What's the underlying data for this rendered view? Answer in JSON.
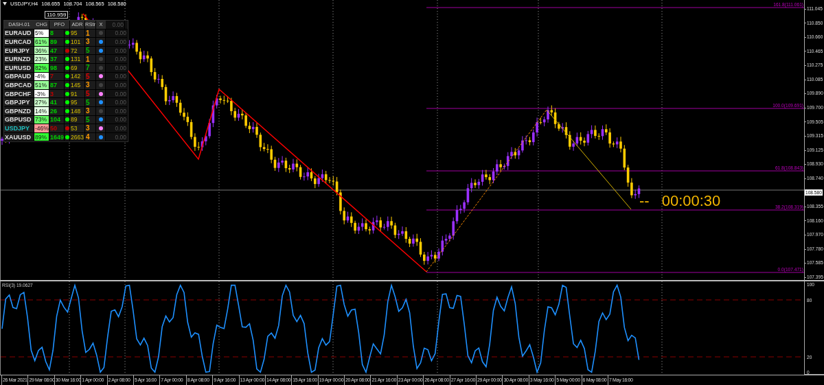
{
  "header": {
    "symbol_timeframe": "USDJPY,H4",
    "ohlc": [
      "108.655",
      "108.704",
      "108.565",
      "108.580"
    ]
  },
  "dashboard": {
    "high_label": "110.959",
    "title": "DASH.01",
    "columns": [
      "CHG",
      "PFO",
      "ADR",
      "RStr"
    ],
    "close": "X",
    "total": "0.00",
    "rows": [
      {
        "symbol": {
          "text": "EURAUD",
          "color": "#e0e0e0"
        },
        "chg": {
          "text": "5%",
          "color": "#ffffff"
        },
        "pfo": {
          "text": "8",
          "color": "#00d000"
        },
        "trend": {
          "color": "#00ff00"
        },
        "adr": "95",
        "rstr": {
          "text": "1",
          "color": "#ff9900"
        },
        "signal": {
          "color": "#404040"
        },
        "value": "0.00"
      },
      {
        "symbol": {
          "text": "EURCAD",
          "color": "#e0e0e0"
        },
        "chg": {
          "text": "61%",
          "color": "#80ff80"
        },
        "pfo": {
          "text": "89",
          "color": "#00d000"
        },
        "trend": {
          "color": "#00ff00"
        },
        "adr": "101",
        "rstr": {
          "text": "3",
          "color": "#ff9900"
        },
        "signal": {
          "color": "#1e90ff"
        },
        "value": "0.00"
      },
      {
        "symbol": {
          "text": "EURJPY",
          "color": "#e0e0e0"
        },
        "chg": {
          "text": "36%",
          "color": "#b8ffb8"
        },
        "pfo": {
          "text": "47",
          "color": "#00d000"
        },
        "trend": {
          "color": "#c00000"
        },
        "adr": "72",
        "rstr": {
          "text": "5",
          "color": "#00c000"
        },
        "signal": {
          "color": "#1e90ff"
        },
        "value": "0.00"
      },
      {
        "symbol": {
          "text": "EURNZD",
          "color": "#e0e0e0"
        },
        "chg": {
          "text": "23%",
          "color": "#d4ffd4"
        },
        "pfo": {
          "text": "37",
          "color": "#00d000"
        },
        "trend": {
          "color": "#00ff00"
        },
        "adr": "131",
        "rstr": {
          "text": "1",
          "color": "#ff9900"
        },
        "signal": {
          "color": "#404040"
        },
        "value": "0.00"
      },
      {
        "symbol": {
          "text": "EURUSD",
          "color": "#e0e0e0"
        },
        "chg": {
          "text": "82%",
          "color": "#4dff4d"
        },
        "pfo": {
          "text": "98",
          "color": "#00d000"
        },
        "trend": {
          "color": "#00ff00"
        },
        "adr": "69",
        "rstr": {
          "text": "7",
          "color": "#00c000"
        },
        "signal": {
          "color": "#404040"
        },
        "value": "0.00"
      },
      {
        "symbol": {
          "text": "GBPAUD",
          "color": "#e0e0e0"
        },
        "chg": {
          "text": "-4%",
          "color": "#ffffff"
        },
        "pfo": {
          "text": "7",
          "color": "#c00000"
        },
        "trend": {
          "color": "#00ff00"
        },
        "adr": "142",
        "rstr": {
          "text": "5",
          "color": "#e00000"
        },
        "signal": {
          "color": "#ff80ff"
        },
        "value": "0.00"
      },
      {
        "symbol": {
          "text": "GBPCAD",
          "color": "#e0e0e0"
        },
        "chg": {
          "text": "51%",
          "color": "#99ff99"
        },
        "pfo": {
          "text": "87",
          "color": "#00d000"
        },
        "trend": {
          "color": "#00ff00"
        },
        "adr": "145",
        "rstr": {
          "text": "3",
          "color": "#ff9900"
        },
        "signal": {
          "color": "#404040"
        },
        "value": "0.00"
      },
      {
        "symbol": {
          "text": "GBPCHF",
          "color": "#e0e0e0"
        },
        "chg": {
          "text": "-3%",
          "color": "#ffffff"
        },
        "pfo": {
          "text": "3",
          "color": "#c00000"
        },
        "trend": {
          "color": "#00ff00"
        },
        "adr": "91",
        "rstr": {
          "text": "5",
          "color": "#e00000"
        },
        "signal": {
          "color": "#ff80ff"
        },
        "value": "0.00"
      },
      {
        "symbol": {
          "text": "GBPJPY",
          "color": "#e0e0e0"
        },
        "chg": {
          "text": "27%",
          "color": "#ccffcc"
        },
        "pfo": {
          "text": "41",
          "color": "#00d000"
        },
        "trend": {
          "color": "#00ff00"
        },
        "adr": "95",
        "rstr": {
          "text": "5",
          "color": "#00c000"
        },
        "signal": {
          "color": "#1e90ff"
        },
        "value": "0.00"
      },
      {
        "symbol": {
          "text": "GBPNZD",
          "color": "#e0e0e0"
        },
        "chg": {
          "text": "14%",
          "color": "#e6ffe6"
        },
        "pfo": {
          "text": "26",
          "color": "#00d000"
        },
        "trend": {
          "color": "#00ff00"
        },
        "adr": "148",
        "rstr": {
          "text": "3",
          "color": "#ff9900"
        },
        "signal": {
          "color": "#404040"
        },
        "value": "0.00"
      },
      {
        "symbol": {
          "text": "GBPUSD",
          "color": "#e0e0e0"
        },
        "chg": {
          "text": "73%",
          "color": "#66ff66"
        },
        "pfo": {
          "text": "104",
          "color": "#00d000"
        },
        "trend": {
          "color": "#00ff00"
        },
        "adr": "89",
        "rstr": {
          "text": "5",
          "color": "#00c000"
        },
        "signal": {
          "color": "#1e90ff"
        },
        "value": "0.00"
      },
      {
        "symbol": {
          "text": "USDJPY",
          "color": "#20c0c0"
        },
        "chg": {
          "text": "-46%",
          "color": "#ff9999"
        },
        "pfo": {
          "text": "50",
          "color": "#c00000"
        },
        "trend": {
          "color": "#c00000"
        },
        "adr": "53",
        "rstr": {
          "text": "3",
          "color": "#ff9900"
        },
        "signal": {
          "color": "#ff80ff"
        },
        "value": "0.00"
      },
      {
        "symbol": {
          "text": "XAUUSD",
          "color": "#e0e0e0"
        },
        "chg": {
          "text": "89%",
          "color": "#33ff33"
        },
        "pfo": {
          "text": "1649",
          "color": "#00d000"
        },
        "trend": {
          "color": "#00ff00"
        },
        "adr": "2663",
        "rstr": {
          "text": "4",
          "color": "#ff9900"
        },
        "signal": {
          "color": "#1e90ff"
        },
        "value": "0.00"
      }
    ]
  },
  "fibonacci_levels": [
    "161.8(111.061)",
    "100.0(109.691)",
    "61.8(108.843)",
    "38.2(108.319)",
    "0.0(107.471)"
  ],
  "countdown": {
    "prefix": "--",
    "time": "00:00:30"
  },
  "price_axis": [
    "111.045",
    "110.850",
    "110.660",
    "110.465",
    "110.275",
    "110.085",
    "109.890",
    "109.700",
    "109.505",
    "109.315",
    "109.125",
    "108.930",
    "108.740",
    "108.355",
    "108.160",
    "107.970",
    "107.780",
    "107.585",
    "107.395"
  ],
  "current_price": "108.580",
  "rsi": {
    "label": "RSI(3) 19.0627",
    "axis": [
      "100",
      "80",
      "20",
      "0"
    ]
  },
  "time_axis": [
    "26 Mar 2021",
    "29 Mar 08:00",
    "30 Mar 16:00",
    "1 Apr 00:00",
    "2 Apr 08:00",
    "5 Apr 16:00",
    "7 Apr 00:00",
    "8 Apr 08:00",
    "9 Apr 16:00",
    "13 Apr 00:00",
    "14 Apr 08:00",
    "15 Apr 16:00",
    "19 Apr 00:00",
    "20 Apr 08:00",
    "21 Apr 16:00",
    "23 Apr 00:00",
    "26 Apr 08:00",
    "27 Apr 16:00",
    "29 Apr 00:00",
    "30 Apr 08:00",
    "3 May 16:00",
    "5 May 00:00",
    "6 May 08:00",
    "7 May 16:00"
  ]
}
